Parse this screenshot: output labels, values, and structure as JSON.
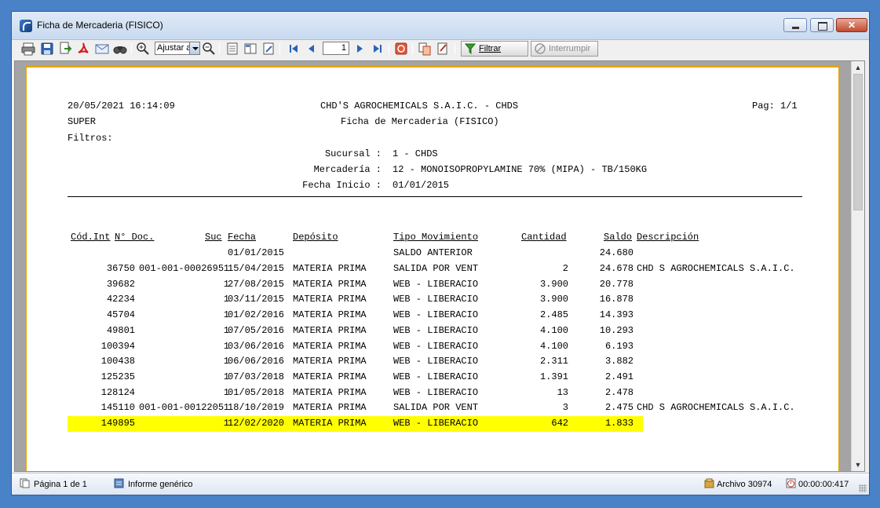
{
  "window": {
    "title": "Ficha de Mercaderia (FISICO)"
  },
  "toolbar": {
    "zoom_value": "Ajustar a",
    "page_value": "1",
    "filter_label": "Filtrar",
    "interrupt_label": "Interrumpir",
    "icons": [
      "print-icon",
      "save-icon",
      "export-icon",
      "pdf-icon",
      "email-icon",
      "find-icon",
      "zoom-in-icon",
      "zoom-out-icon",
      "page-view-icon",
      "two-page-icon",
      "page-setup-icon",
      "first-page-icon",
      "prev-page-icon",
      "next-page-icon",
      "last-page-icon",
      "stop-icon",
      "copy-icon",
      "edit-icon",
      "filter-icon",
      "interrupt-icon"
    ]
  },
  "report": {
    "datetime": "20/05/2021 16:14:09",
    "user": "SUPER",
    "company": "CHD'S AGROCHEMICALS S.A.I.C. - CHDS",
    "title": "Ficha de Mercaderia (FISICO)",
    "page": "Pag: 1/1",
    "filters_label": "Filtros:",
    "filters": [
      {
        "label": "Sucursal :",
        "value": "1 - CHDS"
      },
      {
        "label": "Mercadería :",
        "value": "12 - MONOISOPROPYLAMINE 70% (MIPA) - TB/150KG"
      },
      {
        "label": "Fecha Inicio :",
        "value": "01/01/2015"
      }
    ],
    "columns": [
      "Cód.Int",
      "N° Doc.",
      "Suc",
      "Fecha",
      "Depósito",
      "Tipo Movimiento",
      "Cantidad",
      "Saldo",
      "Descripción"
    ],
    "opening": {
      "fecha": "01/01/2015",
      "tipo": "SALDO ANTERIOR",
      "saldo": "24.680"
    },
    "rows": [
      {
        "cod": "36750",
        "doc": "001-001-0002695",
        "suc": "1",
        "fecha": "15/04/2015",
        "deposito": "MATERIA PRIMA",
        "tipo": "SALIDA POR VENT",
        "cantidad": "2",
        "saldo": "24.678",
        "desc": "CHD S AGROCHEMICALS S.A.I.C."
      },
      {
        "cod": "39682",
        "doc": "",
        "suc": "1",
        "fecha": "27/08/2015",
        "deposito": "MATERIA PRIMA",
        "tipo": "WEB - LIBERACIO",
        "cantidad": "3.900",
        "saldo": "20.778",
        "desc": ""
      },
      {
        "cod": "42234",
        "doc": "",
        "suc": "1",
        "fecha": "03/11/2015",
        "deposito": "MATERIA PRIMA",
        "tipo": "WEB - LIBERACIO",
        "cantidad": "3.900",
        "saldo": "16.878",
        "desc": ""
      },
      {
        "cod": "45704",
        "doc": "",
        "suc": "1",
        "fecha": "01/02/2016",
        "deposito": "MATERIA PRIMA",
        "tipo": "WEB - LIBERACIO",
        "cantidad": "2.485",
        "saldo": "14.393",
        "desc": ""
      },
      {
        "cod": "49801",
        "doc": "",
        "suc": "1",
        "fecha": "07/05/2016",
        "deposito": "MATERIA PRIMA",
        "tipo": "WEB - LIBERACIO",
        "cantidad": "4.100",
        "saldo": "10.293",
        "desc": ""
      },
      {
        "cod": "100394",
        "doc": "",
        "suc": "1",
        "fecha": "03/06/2016",
        "deposito": "MATERIA PRIMA",
        "tipo": "WEB - LIBERACIO",
        "cantidad": "4.100",
        "saldo": "6.193",
        "desc": ""
      },
      {
        "cod": "100438",
        "doc": "",
        "suc": "1",
        "fecha": "06/06/2016",
        "deposito": "MATERIA PRIMA",
        "tipo": "WEB - LIBERACIO",
        "cantidad": "2.311",
        "saldo": "3.882",
        "desc": ""
      },
      {
        "cod": "125235",
        "doc": "",
        "suc": "1",
        "fecha": "07/03/2018",
        "deposito": "MATERIA PRIMA",
        "tipo": "WEB - LIBERACIO",
        "cantidad": "1.391",
        "saldo": "2.491",
        "desc": ""
      },
      {
        "cod": "128124",
        "doc": "",
        "suc": "1",
        "fecha": "01/05/2018",
        "deposito": "MATERIA PRIMA",
        "tipo": "WEB - LIBERACIO",
        "cantidad": "13",
        "saldo": "2.478",
        "desc": ""
      },
      {
        "cod": "145110",
        "doc": "001-001-0012205",
        "suc": "1",
        "fecha": "18/10/2019",
        "deposito": "MATERIA PRIMA",
        "tipo": "SALIDA POR VENT",
        "cantidad": "3",
        "saldo": "2.475",
        "desc": "CHD S AGROCHEMICALS S.A.I.C."
      },
      {
        "cod": "149895",
        "doc": "",
        "suc": "1",
        "fecha": "12/02/2020",
        "deposito": "MATERIA PRIMA",
        "tipo": "WEB - LIBERACIO",
        "cantidad": "642",
        "saldo": "1.833",
        "desc": "",
        "highlight": true
      }
    ]
  },
  "statusbar": {
    "page_info": "Página 1 de 1",
    "report_type": "Informe genérico",
    "file": "Archivo 30974",
    "elapsed": "00:00:00:417"
  },
  "colors": {
    "highlight": "#ffff00",
    "page_border": "#e6a500",
    "viewport_bg": "#a4a4a4"
  }
}
